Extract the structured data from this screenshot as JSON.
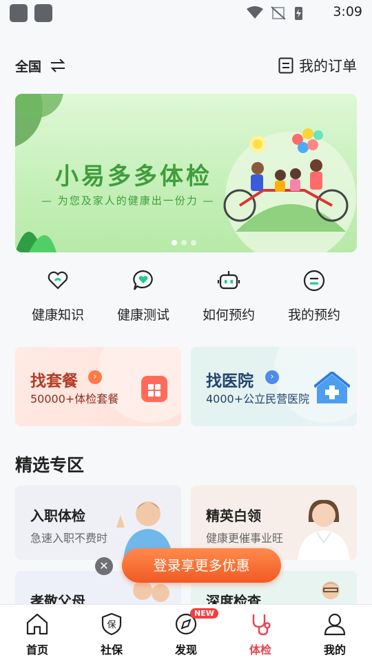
{
  "status_bar": {
    "time": "3:09"
  },
  "header": {
    "region": "全国",
    "orders_label": "我的订单"
  },
  "banner": {
    "title": "小易多多体检",
    "subtitle": "— 为您及家人的健康出一份力 —",
    "page_count": 3,
    "active_index": 0
  },
  "quick_entries": [
    {
      "label": "健康知识",
      "icon": "heart-hand-icon"
    },
    {
      "label": "健康测试",
      "icon": "chat-heart-icon"
    },
    {
      "label": "如何预约",
      "icon": "robot-icon"
    },
    {
      "label": "我的预约",
      "icon": "smile-face-icon"
    }
  ],
  "find_cards": {
    "package": {
      "title": "找套餐",
      "subtitle": "50000+体检套餐"
    },
    "hospital": {
      "title": "找医院",
      "subtitle": "4000+公立民营医院"
    }
  },
  "featured": {
    "title": "精选专区",
    "cards": [
      {
        "title": "入职体检",
        "subtitle": "急速入职不费时"
      },
      {
        "title": "精英白领",
        "subtitle": "健康更催事业旺"
      },
      {
        "title": "孝敬父母",
        "subtitle": ""
      },
      {
        "title": "深度检查",
        "subtitle": ""
      }
    ]
  },
  "login_float": {
    "label": "登录享更多优惠"
  },
  "bottom_nav": {
    "items": [
      {
        "label": "首页",
        "icon": "home-icon"
      },
      {
        "label": "社保",
        "icon": "shield-icon",
        "icon_text": "保"
      },
      {
        "label": "发现",
        "icon": "compass-icon",
        "badge": "NEW"
      },
      {
        "label": "体检",
        "icon": "stethoscope-icon"
      },
      {
        "label": "我的",
        "icon": "user-icon"
      }
    ],
    "active_index": 3
  },
  "colors": {
    "accent_red": "#e8424d",
    "banner_green": "#3f9d3b",
    "login_orange": "#f15a24"
  }
}
